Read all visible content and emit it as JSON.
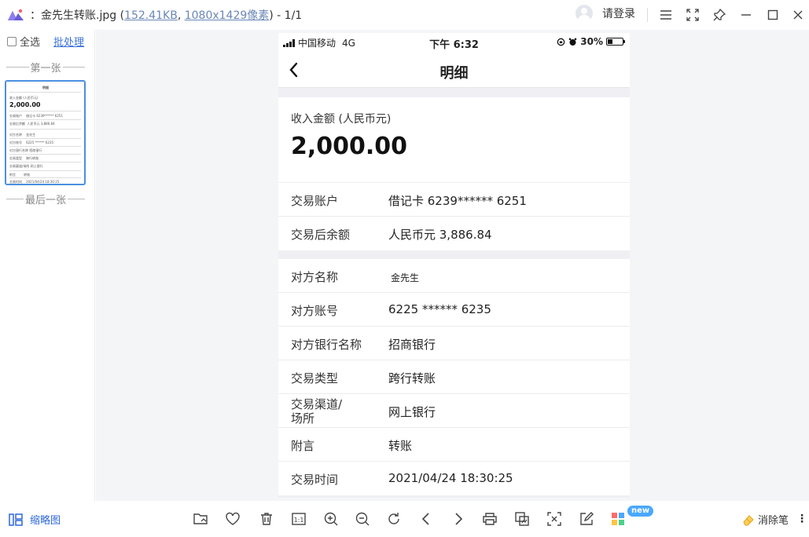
{
  "window": {
    "title_prefix": "：金先生转账.jpg (",
    "file_size": "152.41KB",
    "comma": ", ",
    "dimensions": "1080x1429像素",
    "title_suffix": ") - 1/1",
    "login_label": "请登录"
  },
  "sidebar": {
    "select_all": "全选",
    "batch": "批处理",
    "first_label": "第一张",
    "last_label": "最后一张"
  },
  "phone": {
    "carrier": "中国移动",
    "network": "4G",
    "time": "下午 6:32",
    "battery": "30%",
    "nav_title": "明细",
    "amount_label": "收入金额 (人民币元)",
    "amount_value": "2,000.00",
    "rows1": [
      {
        "key": "交易账户",
        "value": "借记卡 6239****** 6251"
      },
      {
        "key": "交易后余额",
        "value": "人民币元 3,886.84"
      }
    ],
    "rows2": [
      {
        "key": "对方名称",
        "value": "金先生"
      },
      {
        "key": "对方账号",
        "value": "6225 ****** 6235"
      },
      {
        "key": "对方银行名称",
        "value": "招商银行"
      },
      {
        "key": "交易类型",
        "value": "跨行转账"
      },
      {
        "key": "交易渠道/\n场所",
        "value": "网上银行"
      },
      {
        "key": "附言",
        "value": "转账"
      },
      {
        "key": "交易时间",
        "value": "2021/04/24 18:30:25"
      }
    ]
  },
  "bottombar": {
    "thumbs_label": "缩略图",
    "new_badge": "new",
    "eraser_label": "消除笔",
    "more": "⋮",
    "tools": [
      "open-folder-icon",
      "heart-icon",
      "trash-icon",
      "actual-size-icon",
      "zoom-in-icon",
      "zoom-out-icon",
      "rotate-icon",
      "previous-icon",
      "next-icon",
      "print-icon",
      "convert-icon",
      "scan-icon",
      "edit-icon",
      "apps-icon"
    ]
  },
  "colors": {
    "accent": "#3d74d8",
    "thumb_border": "#4a90e2",
    "badge": "#4aa8ff"
  }
}
